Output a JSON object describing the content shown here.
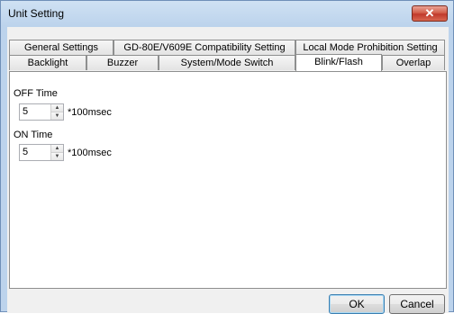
{
  "window": {
    "title": "Unit Setting",
    "close_glyph": "✕"
  },
  "tabs": {
    "row_back": [
      {
        "label": "General Settings"
      },
      {
        "label": "GD-80E/V609E Compatibility Setting"
      },
      {
        "label": "Local Mode Prohibition Setting"
      }
    ],
    "row_front": [
      {
        "label": "Backlight"
      },
      {
        "label": "Buzzer"
      },
      {
        "label": "System/Mode Switch"
      },
      {
        "label": "Blink/Flash"
      },
      {
        "label": "Overlap"
      }
    ],
    "active": "Blink/Flash"
  },
  "blink_flash": {
    "off_time": {
      "label": "OFF Time",
      "value": "5",
      "unit": "*100msec"
    },
    "on_time": {
      "label": "ON Time",
      "value": "5",
      "unit": "*100msec"
    }
  },
  "buttons": {
    "ok": "OK",
    "cancel": "Cancel"
  },
  "icons": {
    "spin_up": "▲",
    "spin_down": "▼"
  }
}
